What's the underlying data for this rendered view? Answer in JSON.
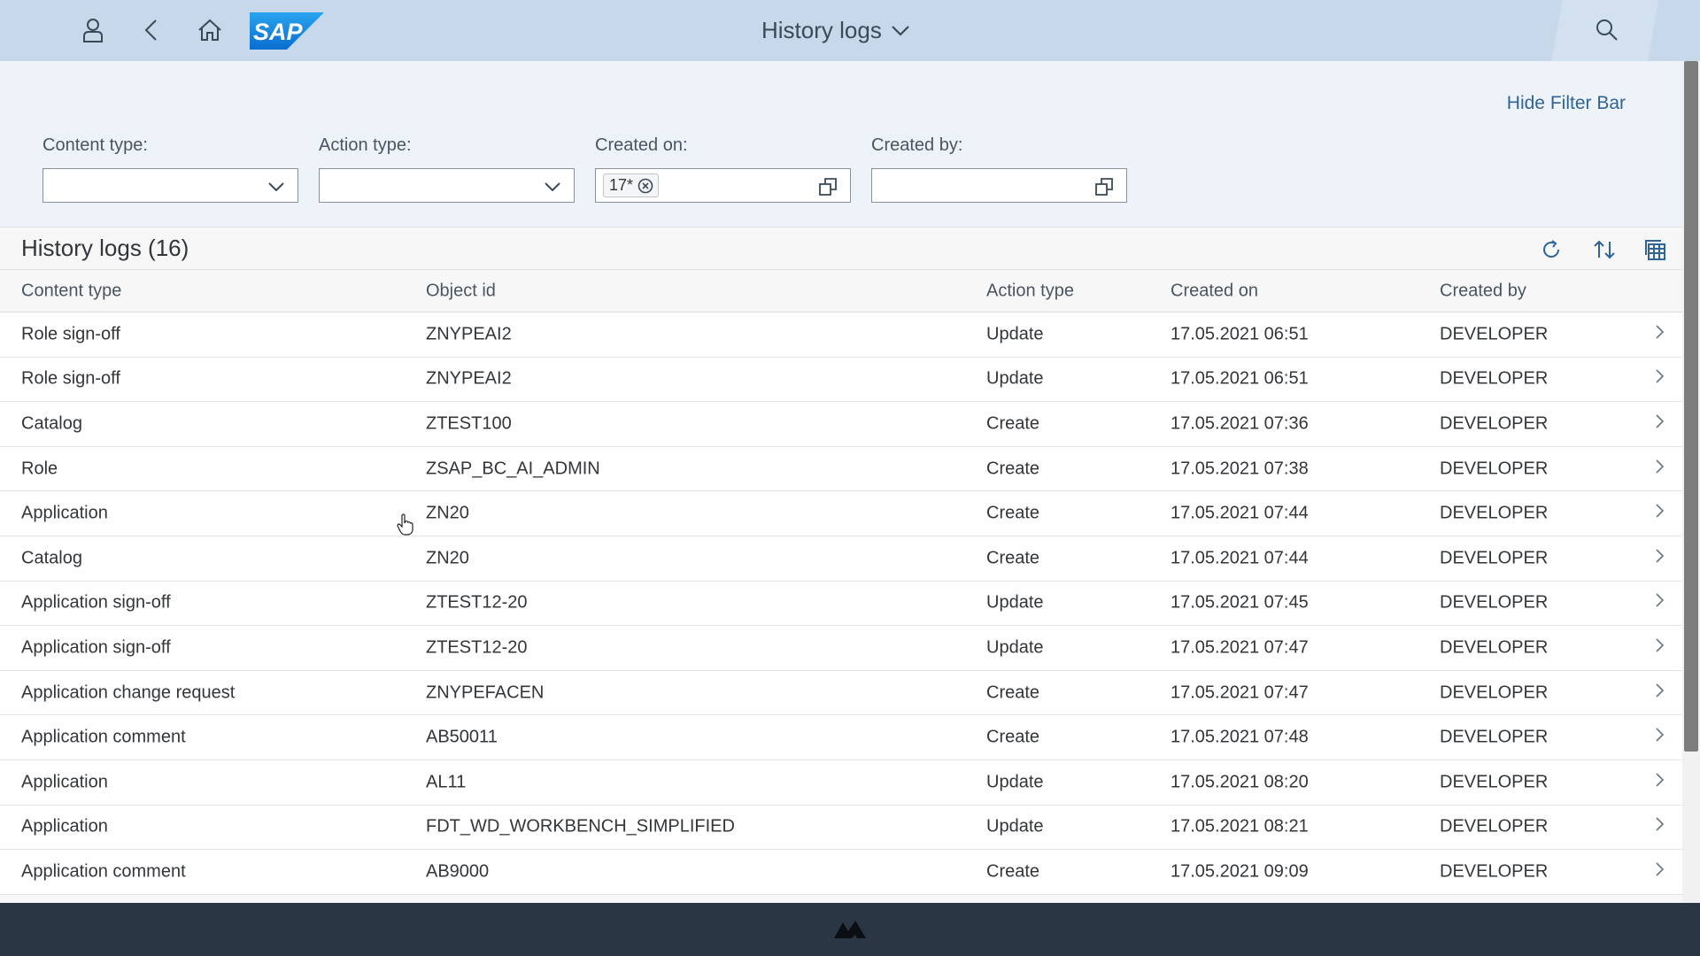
{
  "shell": {
    "title": "History logs",
    "icons": [
      "user-icon",
      "back-icon",
      "home-icon",
      "search-icon"
    ],
    "logo_text": "SAP"
  },
  "filter_bar": {
    "hide_label": "Hide Filter Bar",
    "fields": [
      {
        "label": "Content type:",
        "value": ""
      },
      {
        "label": "Action type:",
        "value": ""
      },
      {
        "label": "Created on:",
        "token": "17*"
      },
      {
        "label": "Created by:",
        "value": ""
      }
    ]
  },
  "table": {
    "title": "History logs (16)",
    "columns": [
      "Content type",
      "Object id",
      "Action type",
      "Created on",
      "Created by"
    ],
    "rows": [
      [
        "Role sign-off",
        "ZNYPEAI2",
        "Update",
        "17.05.2021 06:51",
        "DEVELOPER"
      ],
      [
        "Role sign-off",
        "ZNYPEAI2",
        "Update",
        "17.05.2021 06:51",
        "DEVELOPER"
      ],
      [
        "Catalog",
        "ZTEST100",
        "Create",
        "17.05.2021 07:36",
        "DEVELOPER"
      ],
      [
        "Role",
        "ZSAP_BC_AI_ADMIN",
        "Create",
        "17.05.2021 07:38",
        "DEVELOPER"
      ],
      [
        "Application",
        "ZN20",
        "Create",
        "17.05.2021 07:44",
        "DEVELOPER"
      ],
      [
        "Catalog",
        "ZN20",
        "Create",
        "17.05.2021 07:44",
        "DEVELOPER"
      ],
      [
        "Application sign-off",
        "ZTEST12-20",
        "Update",
        "17.05.2021 07:45",
        "DEVELOPER"
      ],
      [
        "Application sign-off",
        "ZTEST12-20",
        "Update",
        "17.05.2021 07:47",
        "DEVELOPER"
      ],
      [
        "Application change request",
        "ZNYPEFACEN",
        "Create",
        "17.05.2021 07:47",
        "DEVELOPER"
      ],
      [
        "Application comment",
        "AB50011",
        "Create",
        "17.05.2021 07:48",
        "DEVELOPER"
      ],
      [
        "Application",
        "AL11",
        "Update",
        "17.05.2021 08:20",
        "DEVELOPER"
      ],
      [
        "Application",
        "FDT_WD_WORKBENCH_SIMPLIFIED",
        "Update",
        "17.05.2021 08:21",
        "DEVELOPER"
      ],
      [
        "Application comment",
        "AB9000",
        "Create",
        "17.05.2021 09:09",
        "DEVELOPER"
      ]
    ]
  },
  "colors": {
    "shell_bg": "#c7d8eb",
    "filter_bg": "#eef3f9",
    "link": "#2f6497",
    "footer_bg": "#2b3645"
  }
}
